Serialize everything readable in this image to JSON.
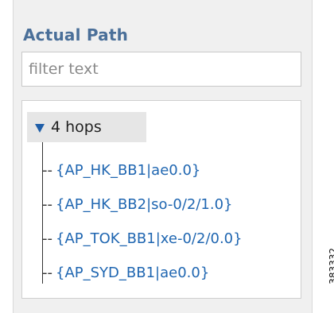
{
  "panel": {
    "title": "Actual Path",
    "filter": {
      "placeholder": "filter text",
      "value": ""
    }
  },
  "tree": {
    "root": {
      "label": "4 hops",
      "expanded": true,
      "icon": "triangle-down-icon",
      "icon_color": "#1f5ea8"
    },
    "hops": [
      {
        "label": "{AP_HK_BB1|ae0.0}"
      },
      {
        "label": "{AP_HK_BB2|so-0/2/1.0}"
      },
      {
        "label": "{AP_TOK_BB1|xe-0/2/0.0}"
      },
      {
        "label": "{AP_SYD_BB1|ae0.0}"
      }
    ],
    "hop_color": "#1f66b1"
  },
  "figure_id": "383332",
  "colors": {
    "title": "#4a6f99",
    "panel_background": "#f0f0f0"
  }
}
